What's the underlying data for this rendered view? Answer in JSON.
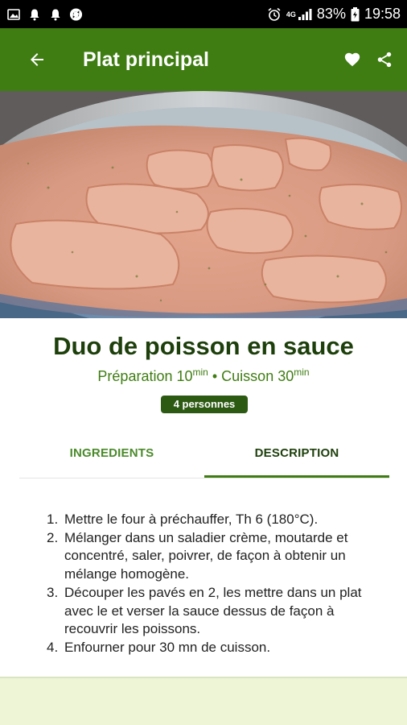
{
  "status_bar": {
    "icons_left": [
      "gallery-icon",
      "notification-bell-icon",
      "notification-bell-icon",
      "sync-icon"
    ],
    "alarm_icon": "alarm-icon",
    "network_label": "4G",
    "battery_percent": "83%",
    "time": "19:58"
  },
  "app_bar": {
    "title": "Plat principal",
    "back_icon": "arrow-back-icon",
    "favorite_icon": "heart-icon",
    "share_icon": "share-icon",
    "color": "#3f7d12"
  },
  "recipe": {
    "title": "Duo de poisson en sauce",
    "prep_label": "Préparation 10",
    "prep_unit": "min",
    "separator": " • ",
    "cook_label": "Cuisson 30",
    "cook_unit": "min",
    "servings": "4 personnes"
  },
  "tabs": [
    {
      "label": "INGREDIENTS",
      "active": false
    },
    {
      "label": "DESCRIPTION",
      "active": true
    }
  ],
  "steps": [
    {
      "num": "1.",
      "text": "Mettre le four à préchauffer, Th 6 (180°C)."
    },
    {
      "num": "2.",
      "text": "Mélanger dans un saladier crème, moutarde et concentré, saler, poivrer, de façon à obtenir un mélange homogène."
    },
    {
      "num": "3.",
      "text": "Découper les pavés en 2, les mettre dans un plat avec le et verser la sauce dessus de façon à recouvrir les poissons."
    },
    {
      "num": "4.",
      "text": "Enfourner pour 30 mn de cuisson."
    }
  ]
}
